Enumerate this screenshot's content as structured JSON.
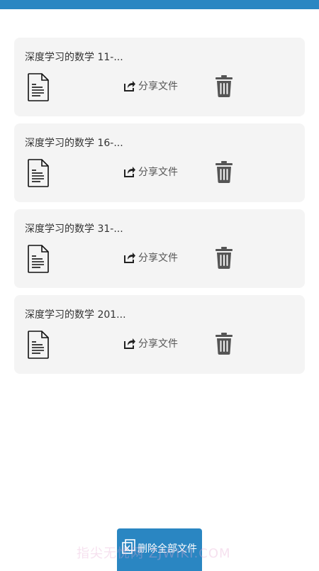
{
  "colors": {
    "primary": "#2a86c2",
    "card_bg": "#f4f4f4"
  },
  "files": [
    {
      "title": "深度学习的数学 11-...",
      "share_label": "分享文件"
    },
    {
      "title": "深度学习的数学 16-...",
      "share_label": "分享文件"
    },
    {
      "title": "深度学习的数学 31-...",
      "share_label": "分享文件"
    },
    {
      "title": "深度学习的数学 201...",
      "share_label": "分享文件"
    }
  ],
  "icons": {
    "file": "document-icon",
    "share": "share-icon",
    "delete": "trash-icon",
    "delete_all": "delete-all-icon"
  },
  "bottom": {
    "delete_all_label": "删除全部文件"
  },
  "watermark": "指尖无忧网 ZJWIKI.COM"
}
